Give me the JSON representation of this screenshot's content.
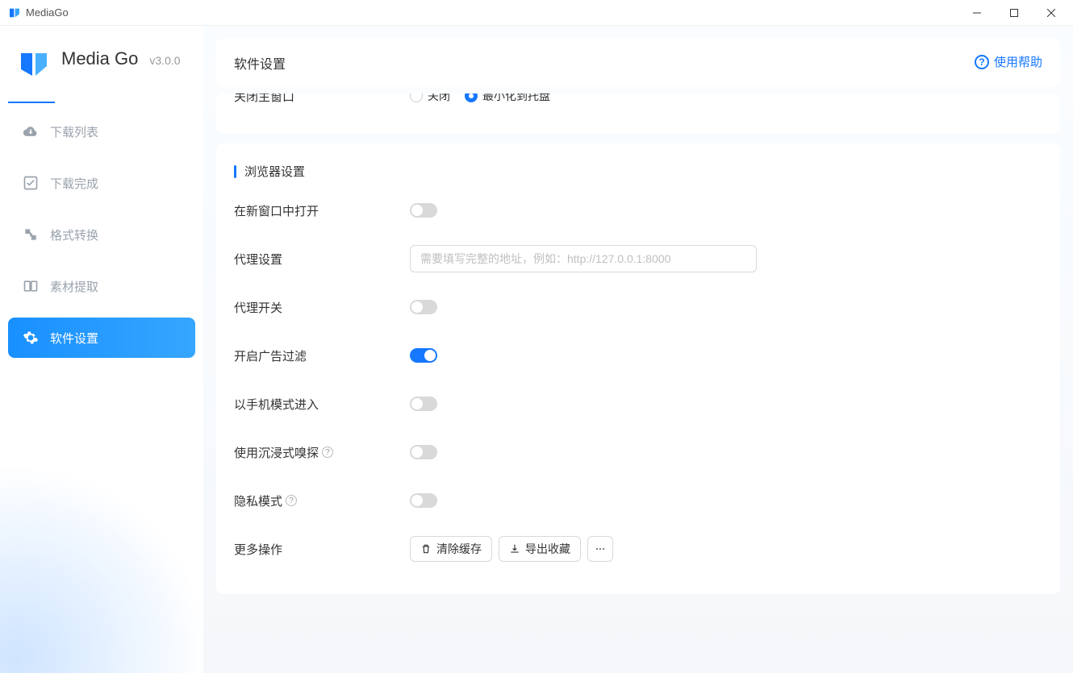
{
  "titlebar": {
    "app_name": "MediaGo"
  },
  "brand": {
    "name": "Media Go",
    "version": "v3.0.0"
  },
  "help_link": "使用帮助",
  "sidebar": {
    "items": [
      {
        "label": "下载列表"
      },
      {
        "label": "下载完成"
      },
      {
        "label": "格式转换"
      },
      {
        "label": "素材提取"
      },
      {
        "label": "软件设置"
      }
    ]
  },
  "page_title": "软件设置",
  "cut_row": {
    "label": "关闭主窗口",
    "options": [
      "关闭",
      "最小化到托盘"
    ]
  },
  "section_browser_title": "浏览器设置",
  "rows": {
    "open_new_window": "在新窗口中打开",
    "proxy_setting": "代理设置",
    "proxy_placeholder": "需要填写完整的地址，例如：http://127.0.0.1:8000",
    "proxy_switch": "代理开关",
    "ad_filter": "开启广告过滤",
    "mobile_mode": "以手机模式进入",
    "immersive_sniff": "使用沉浸式嗅探",
    "private_mode": "隐私模式",
    "more_ops": "更多操作"
  },
  "buttons": {
    "clear_cache": "清除缓存",
    "export_fav": "导出收藏"
  }
}
